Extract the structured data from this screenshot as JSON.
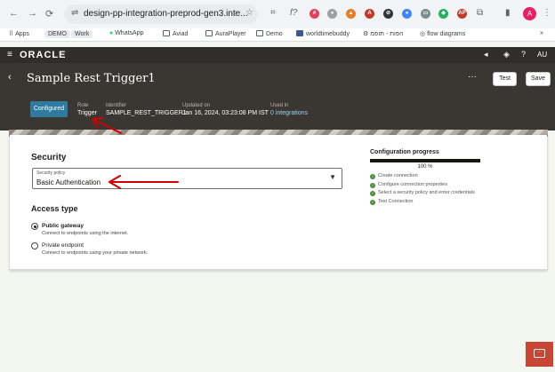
{
  "browser": {
    "url": "design-pp-integration-preprod-gen3.inte...",
    "bookmarks": [
      {
        "label": "Apps"
      },
      {
        "label": "DEMO"
      },
      {
        "label": "Work"
      },
      {
        "label": "WhatsApp"
      },
      {
        "label": "Aviad"
      },
      {
        "label": "AuraPlayer"
      },
      {
        "label": "Demo"
      },
      {
        "label": "worldtimebuddy"
      },
      {
        "label": "הפות - תופמ"
      },
      {
        "label": "flow diagrams"
      }
    ],
    "profile_initial": "A"
  },
  "header": {
    "logo": "ORACLE",
    "user": "AU"
  },
  "page": {
    "title": "Sample Rest Trigger1",
    "test_label": "Test",
    "save_label": "Save",
    "status_badge": "Configured",
    "role_label": "Role",
    "role_value": "Trigger",
    "identifier_label": "Identifier",
    "identifier_value": "SAMPLE_REST_TRIGGER1",
    "updated_label": "Updated on",
    "updated_value": "Jan 16, 2024, 03:23:08 PM IST",
    "used_label": "Used in",
    "used_value": "0 integrations"
  },
  "security": {
    "title": "Security",
    "policy_label": "Security policy",
    "policy_value": "Basic Authentication"
  },
  "access": {
    "title": "Access type",
    "options": [
      {
        "label": "Public gateway",
        "description": "Connect to endpoints using the internet.",
        "selected": true
      },
      {
        "label": "Private endpoint",
        "description": "Connect to endpoints using your private network.",
        "selected": false
      }
    ]
  },
  "progress": {
    "title": "Configuration progress",
    "percent": 100,
    "percent_label": "100 %",
    "steps": [
      {
        "label": "Create connection"
      },
      {
        "label": "Configure connection properties"
      },
      {
        "label": "Select a security policy and enter credentials"
      },
      {
        "label": "Test Connection"
      }
    ]
  },
  "colors": {
    "accent": "#2f7ba0",
    "header_bg": "#312d2a",
    "title_bg": "#3a3632",
    "chat": "#c74634",
    "annotation": "#d00000"
  }
}
